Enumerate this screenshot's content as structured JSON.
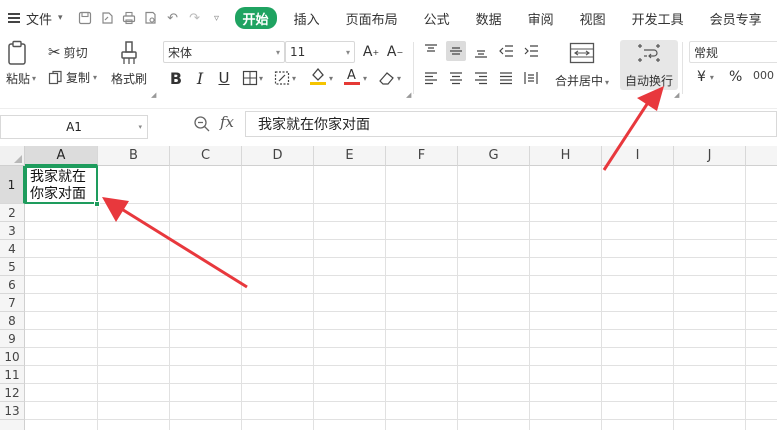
{
  "menu": {
    "file_label": "文件",
    "tabs": [
      "开始",
      "插入",
      "页面布局",
      "公式",
      "数据",
      "审阅",
      "视图",
      "开发工具",
      "会员专享"
    ]
  },
  "ribbon": {
    "paste_label": "粘贴",
    "cut_label": "剪切",
    "copy_label": "复制",
    "format_painter_label": "格式刷",
    "font_name": "宋体",
    "font_size": "11",
    "merge_center_label": "合并居中",
    "wrap_text_label": "自动换行",
    "number_format": "常规",
    "currency_symbol": "¥",
    "percent_symbol": "%"
  },
  "formula_bar": {
    "name_box": "A1",
    "fx_label": "fx",
    "content": "我家就在你家对面"
  },
  "grid": {
    "columns": [
      "A",
      "B",
      "C",
      "D",
      "E",
      "F",
      "G",
      "H",
      "I",
      "J"
    ],
    "rows": [
      "1",
      "2",
      "3",
      "4",
      "5",
      "6",
      "7",
      "8",
      "9",
      "10",
      "11",
      "12",
      "13"
    ],
    "a1_line1": "我家就在",
    "a1_line2": "你家对面"
  },
  "colors": {
    "accent_green": "#1fa361",
    "annotation_red": "#e8383d"
  }
}
